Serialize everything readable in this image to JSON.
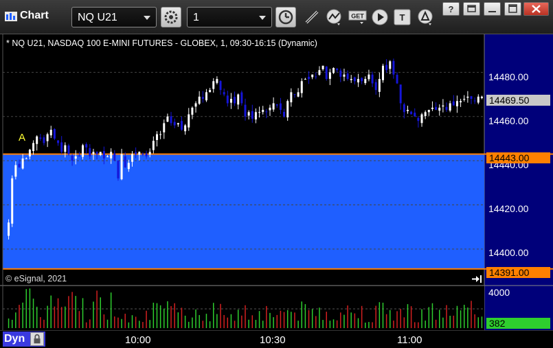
{
  "window": {
    "title": "Chart",
    "symbol": "NQ U21",
    "interval": "1",
    "colors": {
      "titlebar": "#2a2a2a",
      "accent": "#ff8000",
      "band": "#1f5fff",
      "vol_up": "#2ece2e",
      "vol_down": "#d32020"
    }
  },
  "toolbar": {
    "icons": [
      "settings-icon",
      "time-icon",
      "draw-icon",
      "study-icon",
      "get-icon",
      "play-icon",
      "text-tool-icon",
      "alert-icon"
    ]
  },
  "chart": {
    "status_line": "* NQ U21, NASDAQ 100 E-MINI FUTURES - GLOBEX, 1, 09:30-16:15 (Dynamic)",
    "copyright": "© eSignal, 2021",
    "marker": "A",
    "price_ticks": [
      "14480.00",
      "14460.00",
      "14440.00",
      "14420.00",
      "14400.00"
    ],
    "last_price": "14469.50",
    "upper_line": "14443.00",
    "lower_line": "14391.00",
    "volume_max": "4000",
    "volume_last": "382",
    "time_labels": [
      "10:00",
      "10:30",
      "11:00"
    ],
    "panel_label": "Dyn"
  },
  "chart_data": {
    "type": "candlestick",
    "ylim": [
      14390,
      14491
    ],
    "price_ticks": [
      14480,
      14460,
      14440,
      14420,
      14400
    ],
    "bands": [
      {
        "from": 14391,
        "to": 14443
      }
    ],
    "closes": [
      14412,
      14432,
      14438,
      14437,
      14441,
      14441,
      14445,
      14448,
      14451,
      14450,
      14448,
      14452,
      14454,
      14450,
      14448,
      14444,
      14447,
      14443,
      14440,
      14442,
      14442,
      14447,
      14446,
      14442,
      14444,
      14443,
      14444,
      14441,
      14442,
      14444,
      14440,
      14432,
      14443,
      14437,
      14439,
      14443,
      14443,
      14444,
      14443,
      14442,
      14444,
      14449,
      14452,
      14452,
      14457,
      14460,
      14457,
      14456,
      14457,
      14454,
      14456,
      14461,
      14464,
      14466,
      14469,
      14468,
      14471,
      14472,
      14476,
      14477,
      14472,
      14470,
      14466,
      14468,
      14466,
      14470,
      14466,
      14460,
      14462,
      14459,
      14462,
      14462,
      14463,
      14462,
      14464,
      14466,
      14465,
      14463,
      14460,
      14467,
      14471,
      14470,
      14471,
      14476,
      14477,
      14477,
      14479,
      14478,
      14481,
      14483,
      14477,
      14480,
      14482,
      14481,
      14478,
      14479,
      14477,
      14477,
      14476,
      14477,
      14476,
      14477,
      14479,
      14475,
      14472,
      14477,
      14483,
      14481,
      14485,
      14479,
      14475,
      14466,
      14462,
      14463,
      14461,
      14460,
      14458,
      14461,
      14462,
      14463,
      14464,
      14463,
      14464,
      14465,
      14463,
      14466,
      14465,
      14467,
      14467,
      14468,
      14469,
      14468,
      14467,
      14469,
      14469
    ],
    "volume_max": 4000
  }
}
